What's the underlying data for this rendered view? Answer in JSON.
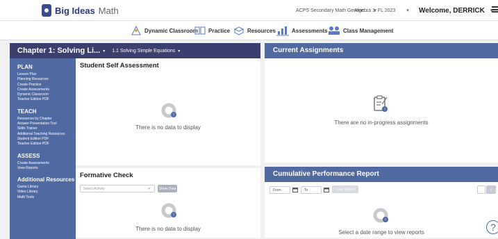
{
  "header": {
    "logo_bold": "Big Ideas",
    "logo_light": "Math",
    "course_select": "ACPS Secondary Math Generic ...",
    "book_select": "Algebra 1: FL 2023",
    "welcome": "Welcome, DERRICK"
  },
  "nav": {
    "items": [
      {
        "label": "Dynamic Classroom",
        "icon": "dynamic-classroom-icon"
      },
      {
        "label": "Practice",
        "icon": "practice-book-icon"
      },
      {
        "label": "Resources",
        "icon": "resources-icon"
      },
      {
        "label": "Assessments",
        "icon": "assessments-chart-icon"
      },
      {
        "label": "Class Management",
        "icon": "class-management-icon"
      }
    ]
  },
  "chapter": {
    "title": "Chapter 1: Solving Li...",
    "section": "1.1 Solving Simple Equations"
  },
  "sidebar": {
    "plan": {
      "heading": "PLAN",
      "links": [
        "Lesson Plan",
        "Planning Resources",
        "Create Practice",
        "Create Assessments",
        "Dynamic Classroom",
        "Teacher Edition PDF"
      ]
    },
    "teach": {
      "heading": "TEACH",
      "links": [
        "Resources by Chapter",
        "Answer Presentation Tool",
        "Skills Trainer",
        "Additional Teaching Resources",
        "Student Edition PDF",
        "Teacher Edition PDF"
      ]
    },
    "assess": {
      "heading": "ASSESS",
      "links": [
        "Create Assessments",
        "View Reports"
      ]
    },
    "additional": {
      "heading": "Additional Resources",
      "links": [
        "Game Library",
        "Video Library",
        "Math Tools"
      ]
    }
  },
  "self_assessment": {
    "title": "Student Self Assessment",
    "empty": "There is no data to display"
  },
  "formative": {
    "title": "Formative Check",
    "select_placeholder": "Select Activity",
    "button": "Show Data",
    "empty": "There is no data to display"
  },
  "assignments": {
    "title": "Current Assignments",
    "empty": "There are no in-progress assignments"
  },
  "cumulative": {
    "title": "Cumulative Performance Report",
    "from": "From",
    "to": "To",
    "button": "Load Report",
    "empty": "Select a date range to view reports"
  },
  "colors": {
    "dark_blue": "#3b3f6d",
    "side_blue": "#4f6aa0"
  }
}
